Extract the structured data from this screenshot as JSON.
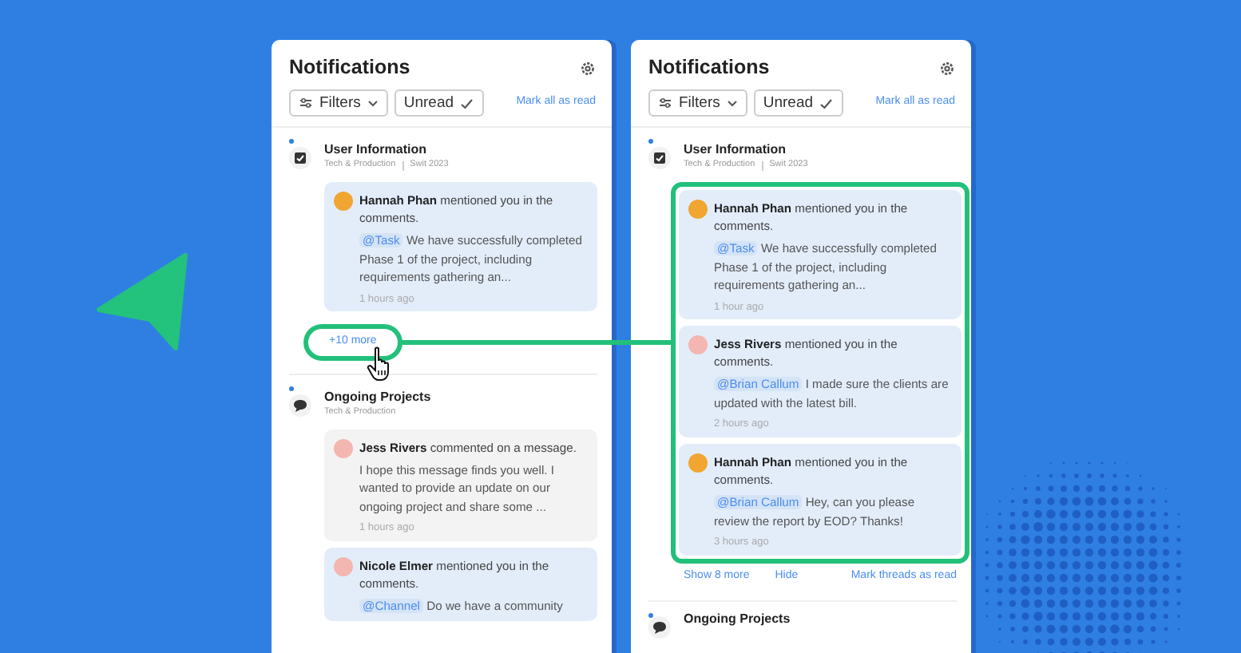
{
  "panels": [
    {
      "title": "Notifications",
      "filters": [
        {
          "label": "Filters",
          "kind": "dropdown"
        },
        {
          "label": "Unread",
          "kind": "toggle",
          "checked": true
        }
      ],
      "mark_all": "Mark all as read",
      "groups": [
        {
          "title": "User Information",
          "subtitle": [
            "Tech & Production",
            "Swit 2023"
          ],
          "kind": "task",
          "unread": true,
          "cards": [
            {
              "text": "**Hannah Phan** mentioned you in the comments.",
              "mention": "@Task",
              "message": "We have successfully completed Phase 1 of the project, including requirements gathering an...",
              "time": "1 hours ago",
              "color": "#f0a630",
              "highlighted": true
            }
          ],
          "more": {
            "label": "+10 more",
            "highlighted": true
          }
        },
        {
          "title": "Ongoing Projects",
          "subtitle": [
            "Tech & Production"
          ],
          "kind": "chat",
          "unread": true,
          "cards": [
            {
              "text": "**Jess Rivers** commented on a message.",
              "message": "I hope this message finds you well. I wanted to provide an update on our ongoing project and share some ...",
              "time": "1 hours ago",
              "color": "#f4b6b0",
              "highlighted": false
            },
            {
              "text": "**Nicole Elmer** mentioned you in the comments.",
              "mention": "@Channel",
              "message": "Do we have a community",
              "color": "#f4b6b0",
              "highlighted": true
            }
          ]
        }
      ]
    },
    {
      "title": "Notifications",
      "filters": [
        {
          "label": "Filters",
          "kind": "dropdown"
        },
        {
          "label": "Unread",
          "kind": "toggle",
          "checked": true
        }
      ],
      "mark_all": "Mark all as read",
      "groups": [
        {
          "title": "User Information",
          "subtitle": [
            "Tech & Production",
            "Swit 2023"
          ],
          "kind": "task",
          "unread": true,
          "highlighted": true,
          "cards": [
            {
              "text": "**Hannah Phan** mentioned you in the comments.",
              "mention": "@Task",
              "message": "We have successfully completed Phase 1 of the project, including requirements gathering an...",
              "time": "1 hour ago",
              "color": "#f0a630",
              "highlighted": true
            },
            {
              "text": "**Jess Rivers** mentioned you in the comments.",
              "mention": "@Brian Callum",
              "message": "I made sure the clients are updated with the latest bill.",
              "time": "2 hours ago",
              "color": "#f4b6b0",
              "highlighted": true
            },
            {
              "text": "**Hannah Phan** mentioned you in the comments.",
              "mention": "@Brian Callum",
              "message": "Hey, can you please review the report by EOD? Thanks!",
              "time": "3 hours ago",
              "color": "#f0a630",
              "highlighted": true
            }
          ],
          "footer": {
            "show_more": "Show 8 more",
            "hide": "Hide",
            "mark_threads": "Mark threads as read"
          }
        },
        {
          "title": "Ongoing Projects",
          "kind": "chat",
          "unread": true
        }
      ]
    }
  ]
}
